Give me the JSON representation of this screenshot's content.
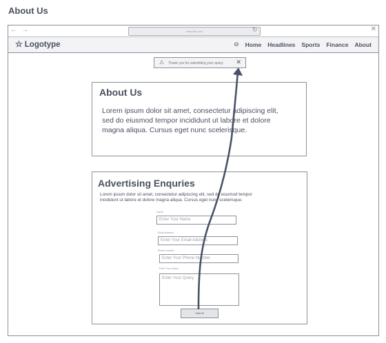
{
  "page_title": "About Us",
  "browser": {
    "nav_arrows": "← →",
    "url": "www.site.com",
    "reload_icon": "↻",
    "close_icon": "✕"
  },
  "navbar": {
    "logo_icon": "☆",
    "logo": "Logotype",
    "menu_icon": "⊖",
    "links": [
      "Home",
      "Headlines",
      "Sports",
      "Finance",
      "About"
    ]
  },
  "toast": {
    "icon": "⚠",
    "message": "Thank you for submitting your query",
    "close": "✕"
  },
  "about_card": {
    "title": "About Us",
    "body": "Lorem ipsum dolor sit amet, consectetur adipiscing elit, sed do eiusmod tempor incididunt ut labore et dolore magna aliqua. Cursus eget nunc scelerisque."
  },
  "enquiries_card": {
    "title": "Advertising Enquries",
    "body": "Lorem ipsum dolor sit amet, consectetur adipiscing elit, sed do eiusmod tempor incididunt ut labore et dolore magna aliqua. Cursus eget nunc scelerisque.",
    "fields": [
      {
        "label": "Name",
        "placeholder": "Enter Your Name"
      },
      {
        "label": "Email Address",
        "placeholder": "Enter Your Email Address"
      },
      {
        "label": "Phone number",
        "placeholder": "Enter Your Phone Number"
      },
      {
        "label": "Enter Your Query",
        "placeholder": "Enter Your Query"
      }
    ],
    "submit": "Submit"
  },
  "colors": {
    "ink": "#4a5060",
    "border": "#8a8f99",
    "arrow": "#4a5268"
  }
}
